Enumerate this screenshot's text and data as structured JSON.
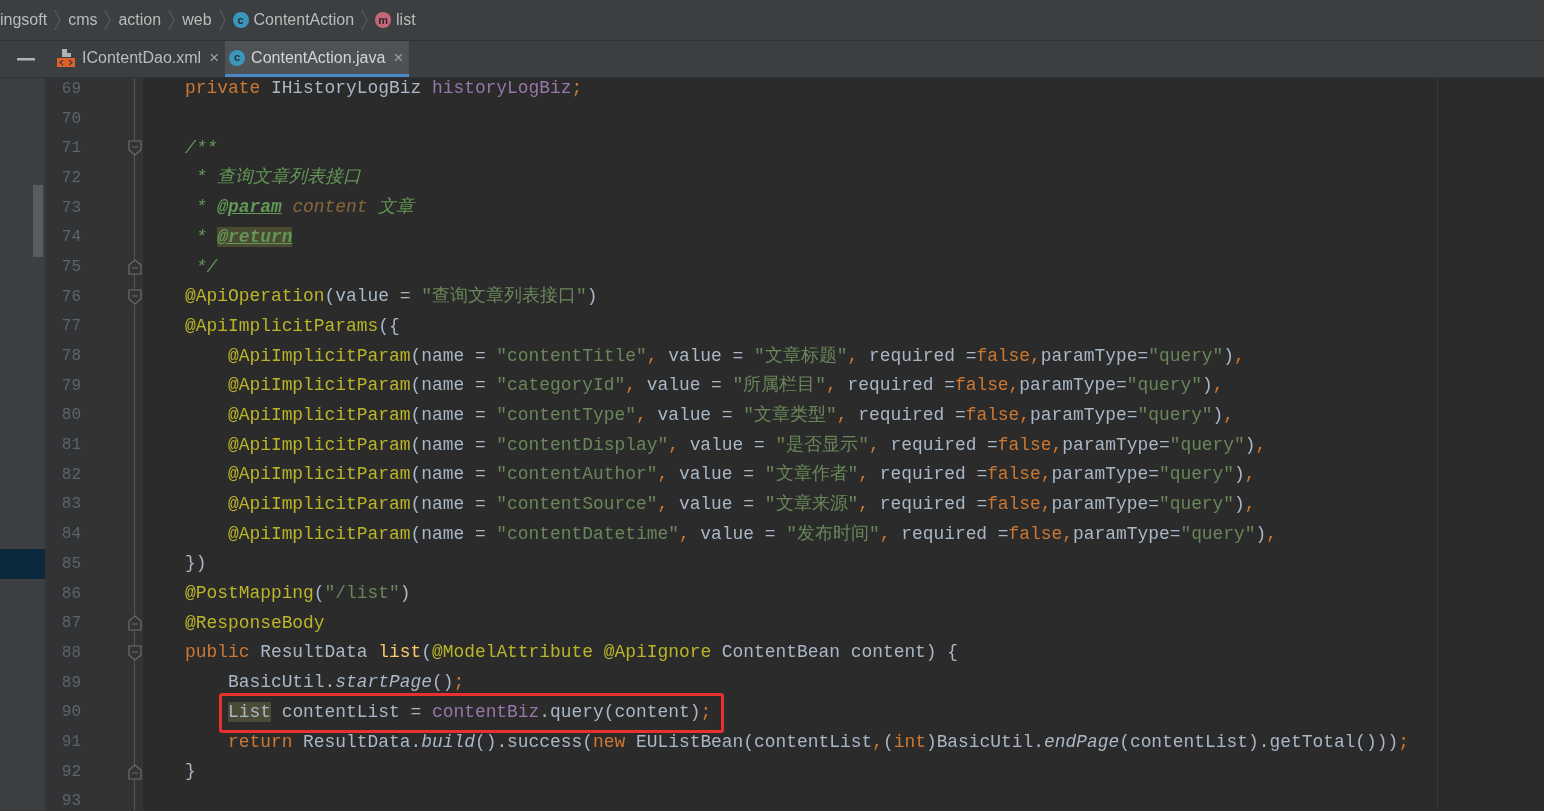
{
  "breadcrumb": [
    {
      "label": "ingsoft",
      "kind": "folder"
    },
    {
      "label": "cms",
      "kind": "folder"
    },
    {
      "label": "action",
      "kind": "folder"
    },
    {
      "label": "web",
      "kind": "folder"
    },
    {
      "label": "ContentAction",
      "kind": "class",
      "icon_letter": "c"
    },
    {
      "label": "list",
      "kind": "method",
      "icon_letter": "m"
    }
  ],
  "tabs": [
    {
      "label": "IContentDao.xml",
      "kind": "xml",
      "close": "×",
      "selected": false
    },
    {
      "label": "ContentAction.java",
      "kind": "class",
      "icon_letter": "c",
      "close": "×",
      "selected": true
    }
  ],
  "lines": [
    {
      "number": "69",
      "kind": "plain",
      "current": false,
      "tokens": [
        {
          "kind": "keyword",
          "text": "private "
        },
        {
          "kind": "plain",
          "text": "IHistoryLogBiz "
        },
        {
          "kind": "field",
          "text": "historyLogBiz"
        },
        {
          "kind": "keyword",
          "text": ";"
        }
      ]
    },
    {
      "number": "70",
      "kind": "plain",
      "current": false
    },
    {
      "number": "71",
      "kind": "fold_start",
      "current": false,
      "tokens": [
        {
          "kind": "comment",
          "text": "/**"
        }
      ]
    },
    {
      "number": "72",
      "kind": "plain",
      "current": false,
      "tokens": [
        {
          "kind": "comment",
          "text": " * 查询文章列表接口"
        }
      ]
    },
    {
      "number": "73",
      "kind": "plain",
      "current": false,
      "tokens": [
        {
          "kind": "comment",
          "text": " * "
        },
        {
          "kind": "doc_tag",
          "text": "@param"
        },
        {
          "kind": "doc_param",
          "text": " content"
        },
        {
          "kind": "comment",
          "text": " 文章"
        }
      ]
    },
    {
      "number": "74",
      "kind": "plain",
      "current": false,
      "tokens": [
        {
          "kind": "comment",
          "text": " * "
        },
        {
          "kind": "doc_tag_marked",
          "text": "@return"
        }
      ]
    },
    {
      "number": "75",
      "kind": "fold_end",
      "current": false,
      "tokens": [
        {
          "kind": "comment",
          "text": " */"
        }
      ]
    },
    {
      "number": "76",
      "kind": "fold_start",
      "current": false,
      "tokens": [
        {
          "kind": "annotation",
          "text": "@ApiOperation"
        },
        {
          "kind": "plain",
          "text": "(value = "
        },
        {
          "kind": "string",
          "text": "\"查询文章列表接口\""
        },
        {
          "kind": "plain",
          "text": ")"
        }
      ]
    },
    {
      "number": "77",
      "kind": "plain",
      "current": false,
      "tokens": [
        {
          "kind": "annotation",
          "text": "@ApiImplicitParams"
        },
        {
          "kind": "plain",
          "text": "({"
        }
      ]
    },
    {
      "number": "78",
      "kind": "plain",
      "current": false,
      "tokens": [
        {
          "kind": "annotation",
          "text": "    @ApiImplicitParam"
        },
        {
          "kind": "plain",
          "text": "(name = "
        },
        {
          "kind": "string",
          "text": "\"contentTitle\""
        },
        {
          "kind": "keyword",
          "text": ", "
        },
        {
          "kind": "plain",
          "text": "value = "
        },
        {
          "kind": "string",
          "text": "\"文章标题\""
        },
        {
          "kind": "keyword",
          "text": ", "
        },
        {
          "kind": "plain",
          "text": "required ="
        },
        {
          "kind": "keyword",
          "text": "false,"
        },
        {
          "kind": "plain",
          "text": "paramType="
        },
        {
          "kind": "string",
          "text": "\"query\""
        },
        {
          "kind": "plain",
          "text": ")"
        },
        {
          "kind": "keyword",
          "text": ","
        }
      ]
    },
    {
      "number": "79",
      "kind": "plain",
      "current": false,
      "tokens": [
        {
          "kind": "annotation",
          "text": "    @ApiImplicitParam"
        },
        {
          "kind": "plain",
          "text": "(name = "
        },
        {
          "kind": "string",
          "text": "\"categoryId\""
        },
        {
          "kind": "keyword",
          "text": ", "
        },
        {
          "kind": "plain",
          "text": "value = "
        },
        {
          "kind": "string",
          "text": "\"所属栏目\""
        },
        {
          "kind": "keyword",
          "text": ", "
        },
        {
          "kind": "plain",
          "text": "required ="
        },
        {
          "kind": "keyword",
          "text": "false,"
        },
        {
          "kind": "plain",
          "text": "paramType="
        },
        {
          "kind": "string",
          "text": "\"query\""
        },
        {
          "kind": "plain",
          "text": ")"
        },
        {
          "kind": "keyword",
          "text": ","
        }
      ]
    },
    {
      "number": "80",
      "kind": "plain",
      "current": false,
      "tokens": [
        {
          "kind": "annotation",
          "text": "    @ApiImplicitParam"
        },
        {
          "kind": "plain",
          "text": "(name = "
        },
        {
          "kind": "string",
          "text": "\"contentType\""
        },
        {
          "kind": "keyword",
          "text": ", "
        },
        {
          "kind": "plain",
          "text": "value = "
        },
        {
          "kind": "string",
          "text": "\"文章类型\""
        },
        {
          "kind": "keyword",
          "text": ", "
        },
        {
          "kind": "plain",
          "text": "required ="
        },
        {
          "kind": "keyword",
          "text": "false,"
        },
        {
          "kind": "plain",
          "text": "paramType="
        },
        {
          "kind": "string",
          "text": "\"query\""
        },
        {
          "kind": "plain",
          "text": ")"
        },
        {
          "kind": "keyword",
          "text": ","
        }
      ]
    },
    {
      "number": "81",
      "kind": "plain",
      "current": false,
      "tokens": [
        {
          "kind": "annotation",
          "text": "    @ApiImplicitParam"
        },
        {
          "kind": "plain",
          "text": "(name = "
        },
        {
          "kind": "string",
          "text": "\"contentDisplay\""
        },
        {
          "kind": "keyword",
          "text": ", "
        },
        {
          "kind": "plain",
          "text": "value = "
        },
        {
          "kind": "string",
          "text": "\"是否显示\""
        },
        {
          "kind": "keyword",
          "text": ", "
        },
        {
          "kind": "plain",
          "text": "required ="
        },
        {
          "kind": "keyword",
          "text": "false,"
        },
        {
          "kind": "plain",
          "text": "paramType="
        },
        {
          "kind": "string",
          "text": "\"query\""
        },
        {
          "kind": "plain",
          "text": ")"
        },
        {
          "kind": "keyword",
          "text": ","
        }
      ]
    },
    {
      "number": "82",
      "kind": "plain",
      "current": false,
      "tokens": [
        {
          "kind": "annotation",
          "text": "    @ApiImplicitParam"
        },
        {
          "kind": "plain",
          "text": "(name = "
        },
        {
          "kind": "string",
          "text": "\"contentAuthor\""
        },
        {
          "kind": "keyword",
          "text": ", "
        },
        {
          "kind": "plain",
          "text": "value = "
        },
        {
          "kind": "string",
          "text": "\"文章作者\""
        },
        {
          "kind": "keyword",
          "text": ", "
        },
        {
          "kind": "plain",
          "text": "required ="
        },
        {
          "kind": "keyword",
          "text": "false,"
        },
        {
          "kind": "plain",
          "text": "paramType="
        },
        {
          "kind": "string",
          "text": "\"query\""
        },
        {
          "kind": "plain",
          "text": ")"
        },
        {
          "kind": "keyword",
          "text": ","
        }
      ]
    },
    {
      "number": "83",
      "kind": "plain",
      "current": false,
      "tokens": [
        {
          "kind": "annotation",
          "text": "    @ApiImplicitParam"
        },
        {
          "kind": "plain",
          "text": "(name = "
        },
        {
          "kind": "string",
          "text": "\"contentSource\""
        },
        {
          "kind": "keyword",
          "text": ", "
        },
        {
          "kind": "plain",
          "text": "value = "
        },
        {
          "kind": "string",
          "text": "\"文章来源\""
        },
        {
          "kind": "keyword",
          "text": ", "
        },
        {
          "kind": "plain",
          "text": "required ="
        },
        {
          "kind": "keyword",
          "text": "false,"
        },
        {
          "kind": "plain",
          "text": "paramType="
        },
        {
          "kind": "string",
          "text": "\"query\""
        },
        {
          "kind": "plain",
          "text": ")"
        },
        {
          "kind": "keyword",
          "text": ","
        }
      ]
    },
    {
      "number": "84",
      "kind": "plain",
      "current": false,
      "tokens": [
        {
          "kind": "annotation",
          "text": "    @ApiImplicitParam"
        },
        {
          "kind": "plain",
          "text": "(name = "
        },
        {
          "kind": "string",
          "text": "\"contentDatetime\""
        },
        {
          "kind": "keyword",
          "text": ", "
        },
        {
          "kind": "plain",
          "text": "value = "
        },
        {
          "kind": "string",
          "text": "\"发布时间\""
        },
        {
          "kind": "keyword",
          "text": ", "
        },
        {
          "kind": "plain",
          "text": "required ="
        },
        {
          "kind": "keyword",
          "text": "false,"
        },
        {
          "kind": "plain",
          "text": "paramType="
        },
        {
          "kind": "string",
          "text": "\"query\""
        },
        {
          "kind": "plain",
          "text": ")"
        },
        {
          "kind": "keyword",
          "text": ","
        }
      ]
    },
    {
      "number": "85",
      "kind": "plain",
      "current": true,
      "tokens": [
        {
          "kind": "plain",
          "text": "})"
        }
      ]
    },
    {
      "number": "86",
      "kind": "plain",
      "current": false,
      "tokens": [
        {
          "kind": "annotation",
          "text": "@PostMapping"
        },
        {
          "kind": "plain",
          "text": "("
        },
        {
          "kind": "string",
          "text": "\"/list\""
        },
        {
          "kind": "plain",
          "text": ")"
        }
      ]
    },
    {
      "number": "87",
      "kind": "fold_end",
      "current": false,
      "tokens": [
        {
          "kind": "annotation",
          "text": "@ResponseBody"
        }
      ]
    },
    {
      "number": "88",
      "kind": "fold_start",
      "current": false,
      "tokens": [
        {
          "kind": "keyword",
          "text": "public "
        },
        {
          "kind": "plain",
          "text": "ResultData "
        },
        {
          "kind": "method",
          "text": "list"
        },
        {
          "kind": "plain",
          "text": "("
        },
        {
          "kind": "annotation",
          "text": "@ModelAttribute "
        },
        {
          "kind": "annotation",
          "text": "@ApiIgnore"
        },
        {
          "kind": "plain",
          "text": " ContentBean content) {"
        }
      ]
    },
    {
      "number": "89",
      "kind": "plain",
      "current": false,
      "tokens": [
        {
          "kind": "plain",
          "text": "    BasicUtil."
        },
        {
          "kind": "static",
          "text": "startPage"
        },
        {
          "kind": "plain",
          "text": "()"
        },
        {
          "kind": "keyword",
          "text": ";"
        }
      ]
    },
    {
      "number": "90",
      "kind": "plain",
      "current": false,
      "boxed": true,
      "tokens": [
        {
          "kind": "type_marked",
          "text": "    List"
        },
        {
          "kind": "plain",
          "text": " contentList = "
        },
        {
          "kind": "field",
          "text": "contentBiz"
        },
        {
          "kind": "plain",
          "text": ".query(content)"
        },
        {
          "kind": "keyword",
          "text": ";"
        }
      ]
    },
    {
      "number": "91",
      "kind": "plain",
      "current": false,
      "tokens": [
        {
          "kind": "keyword",
          "text": "    return "
        },
        {
          "kind": "plain",
          "text": "ResultData."
        },
        {
          "kind": "static",
          "text": "build"
        },
        {
          "kind": "plain",
          "text": "().success("
        },
        {
          "kind": "keyword",
          "text": "new "
        },
        {
          "kind": "plain",
          "text": "EUListBean(contentList"
        },
        {
          "kind": "keyword",
          "text": ","
        },
        {
          "kind": "plain",
          "text": "("
        },
        {
          "kind": "keyword",
          "text": "int"
        },
        {
          "kind": "plain",
          "text": ")BasicUtil."
        },
        {
          "kind": "static",
          "text": "endPage"
        },
        {
          "kind": "plain",
          "text": "(contentList).getTotal()))"
        },
        {
          "kind": "keyword",
          "text": ";"
        }
      ]
    },
    {
      "number": "92",
      "kind": "fold_end",
      "current": false,
      "tokens": [
        {
          "kind": "plain",
          "text": "}"
        }
      ]
    },
    {
      "number": "93",
      "kind": "plain",
      "current": false
    }
  ]
}
